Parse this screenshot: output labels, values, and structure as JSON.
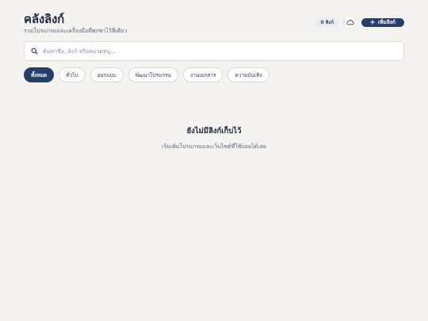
{
  "header": {
    "title": "คลังลิงก์",
    "subtitle": "รวมโปรแกรมและเครื่องมือที่พกพาไว้ที่เดียว",
    "count_badge": "0 ลิงก์",
    "add_label": "เพิ่มลิงก์",
    "add_icon": "plus-icon",
    "cloud_icon": "cloud-icon"
  },
  "search": {
    "placeholder": "ค้นหาชื่อ, ลิงก์ หรือหมวดหมู่...",
    "value": "",
    "icon": "search-icon"
  },
  "filters": {
    "active_index": 0,
    "items": [
      {
        "label": "ทั้งหมด"
      },
      {
        "label": "ทั่วไป"
      },
      {
        "label": "ออกแบบ"
      },
      {
        "label": "พัฒนาโปรแกรม"
      },
      {
        "label": "งานเอกสาร"
      },
      {
        "label": "ความบันเทิง"
      }
    ]
  },
  "empty_state": {
    "title": "ยังไม่มีลิงก์เก็บไว้",
    "text": "เริ่มเพิ่มโปรแกรมและเว็บไซต์ที่ใช้บ่อยได้เลย"
  },
  "colors": {
    "background": "#f4f3f0",
    "primary": "#253e6b",
    "text": "#1c2740",
    "muted": "#5b6478"
  }
}
